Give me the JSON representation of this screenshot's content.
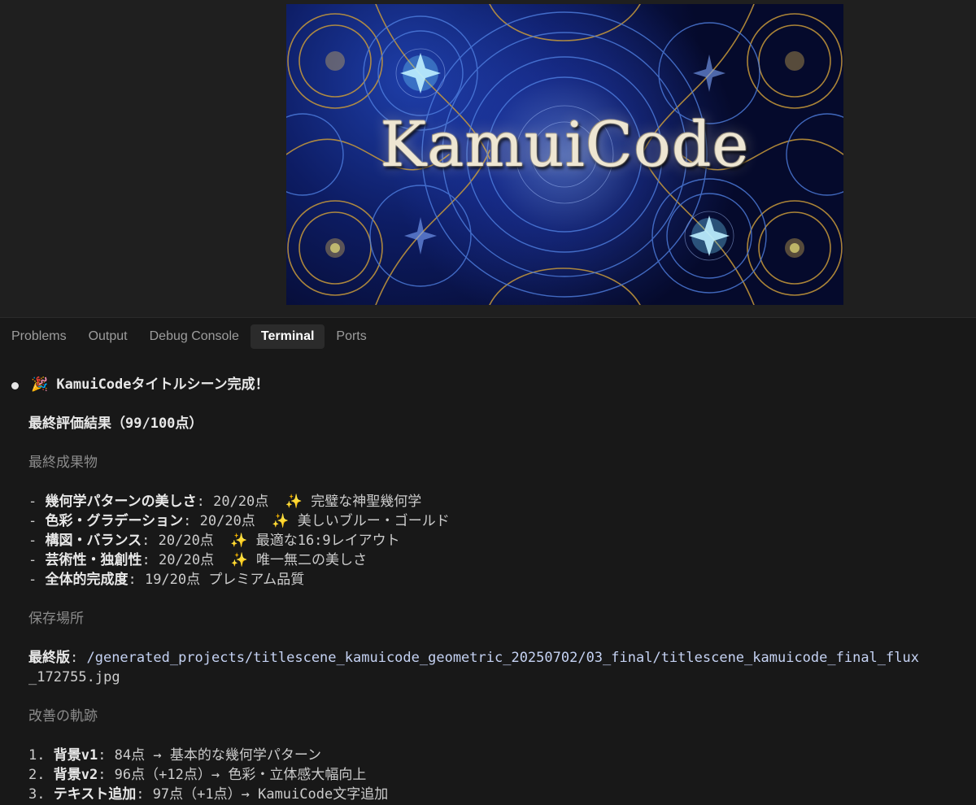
{
  "banner": {
    "title": "KamuiCode"
  },
  "panel": {
    "tabs": [
      {
        "label": "Problems",
        "active": false
      },
      {
        "label": "Output",
        "active": false
      },
      {
        "label": "Debug Console",
        "active": false
      },
      {
        "label": "Terminal",
        "active": true
      },
      {
        "label": "Ports",
        "active": false
      }
    ]
  },
  "terminal": {
    "headline_icon": "party-popper-icon",
    "headline": "🎉 KamuiCodeタイトルシーン完成！",
    "final_eval": "最終評価結果（99/100点）",
    "section_result": "最終成果物",
    "scores": [
      {
        "name": "幾何学パターンの美しさ",
        "score": ": 20/20点",
        "spark": "✨",
        "note": " 完璧な神聖幾何学"
      },
      {
        "name": "色彩・グラデーション",
        "score": ": 20/20点",
        "spark": "✨",
        "note": " 美しいブルー・ゴールド"
      },
      {
        "name": "構図・バランス",
        "score": ": 20/20点",
        "spark": "✨",
        "note": " 最適な16:9レイアウト"
      },
      {
        "name": "芸術性・独創性",
        "score": ": 20/20点",
        "spark": "✨",
        "note": " 唯一無二の美しさ"
      },
      {
        "name": "全体的完成度",
        "score": ": 19/20点",
        "spark": "",
        "note": "プレミアム品質"
      }
    ],
    "section_location": "保存場所",
    "final_label": "最終版",
    "final_path_line1": "/generated_projects/titlescene_kamuicode_geometric_20250702/03_final/titlescene_kamuicode_final_flux",
    "final_path_line2": "_172755.jpg",
    "section_improve": "改善の軌跡",
    "improvements": [
      {
        "num": "1. ",
        "name": "背景v1",
        "rest": ": 84点 → 基本的な幾何学パターン"
      },
      {
        "num": "2. ",
        "name": "背景v2",
        "rest": ": 96点（+12点）→ 色彩・立体感大幅向上"
      },
      {
        "num": "3. ",
        "name": "テキスト追加",
        "rest": ": 97点（+1点）→ KamuiCode文字追加"
      }
    ]
  },
  "colors": {
    "panel_bg": "#181818",
    "text": "#cccccc",
    "path": "#c5d2f3",
    "banner_blue": "#102a8a",
    "banner_gold": "#c89a3a"
  }
}
